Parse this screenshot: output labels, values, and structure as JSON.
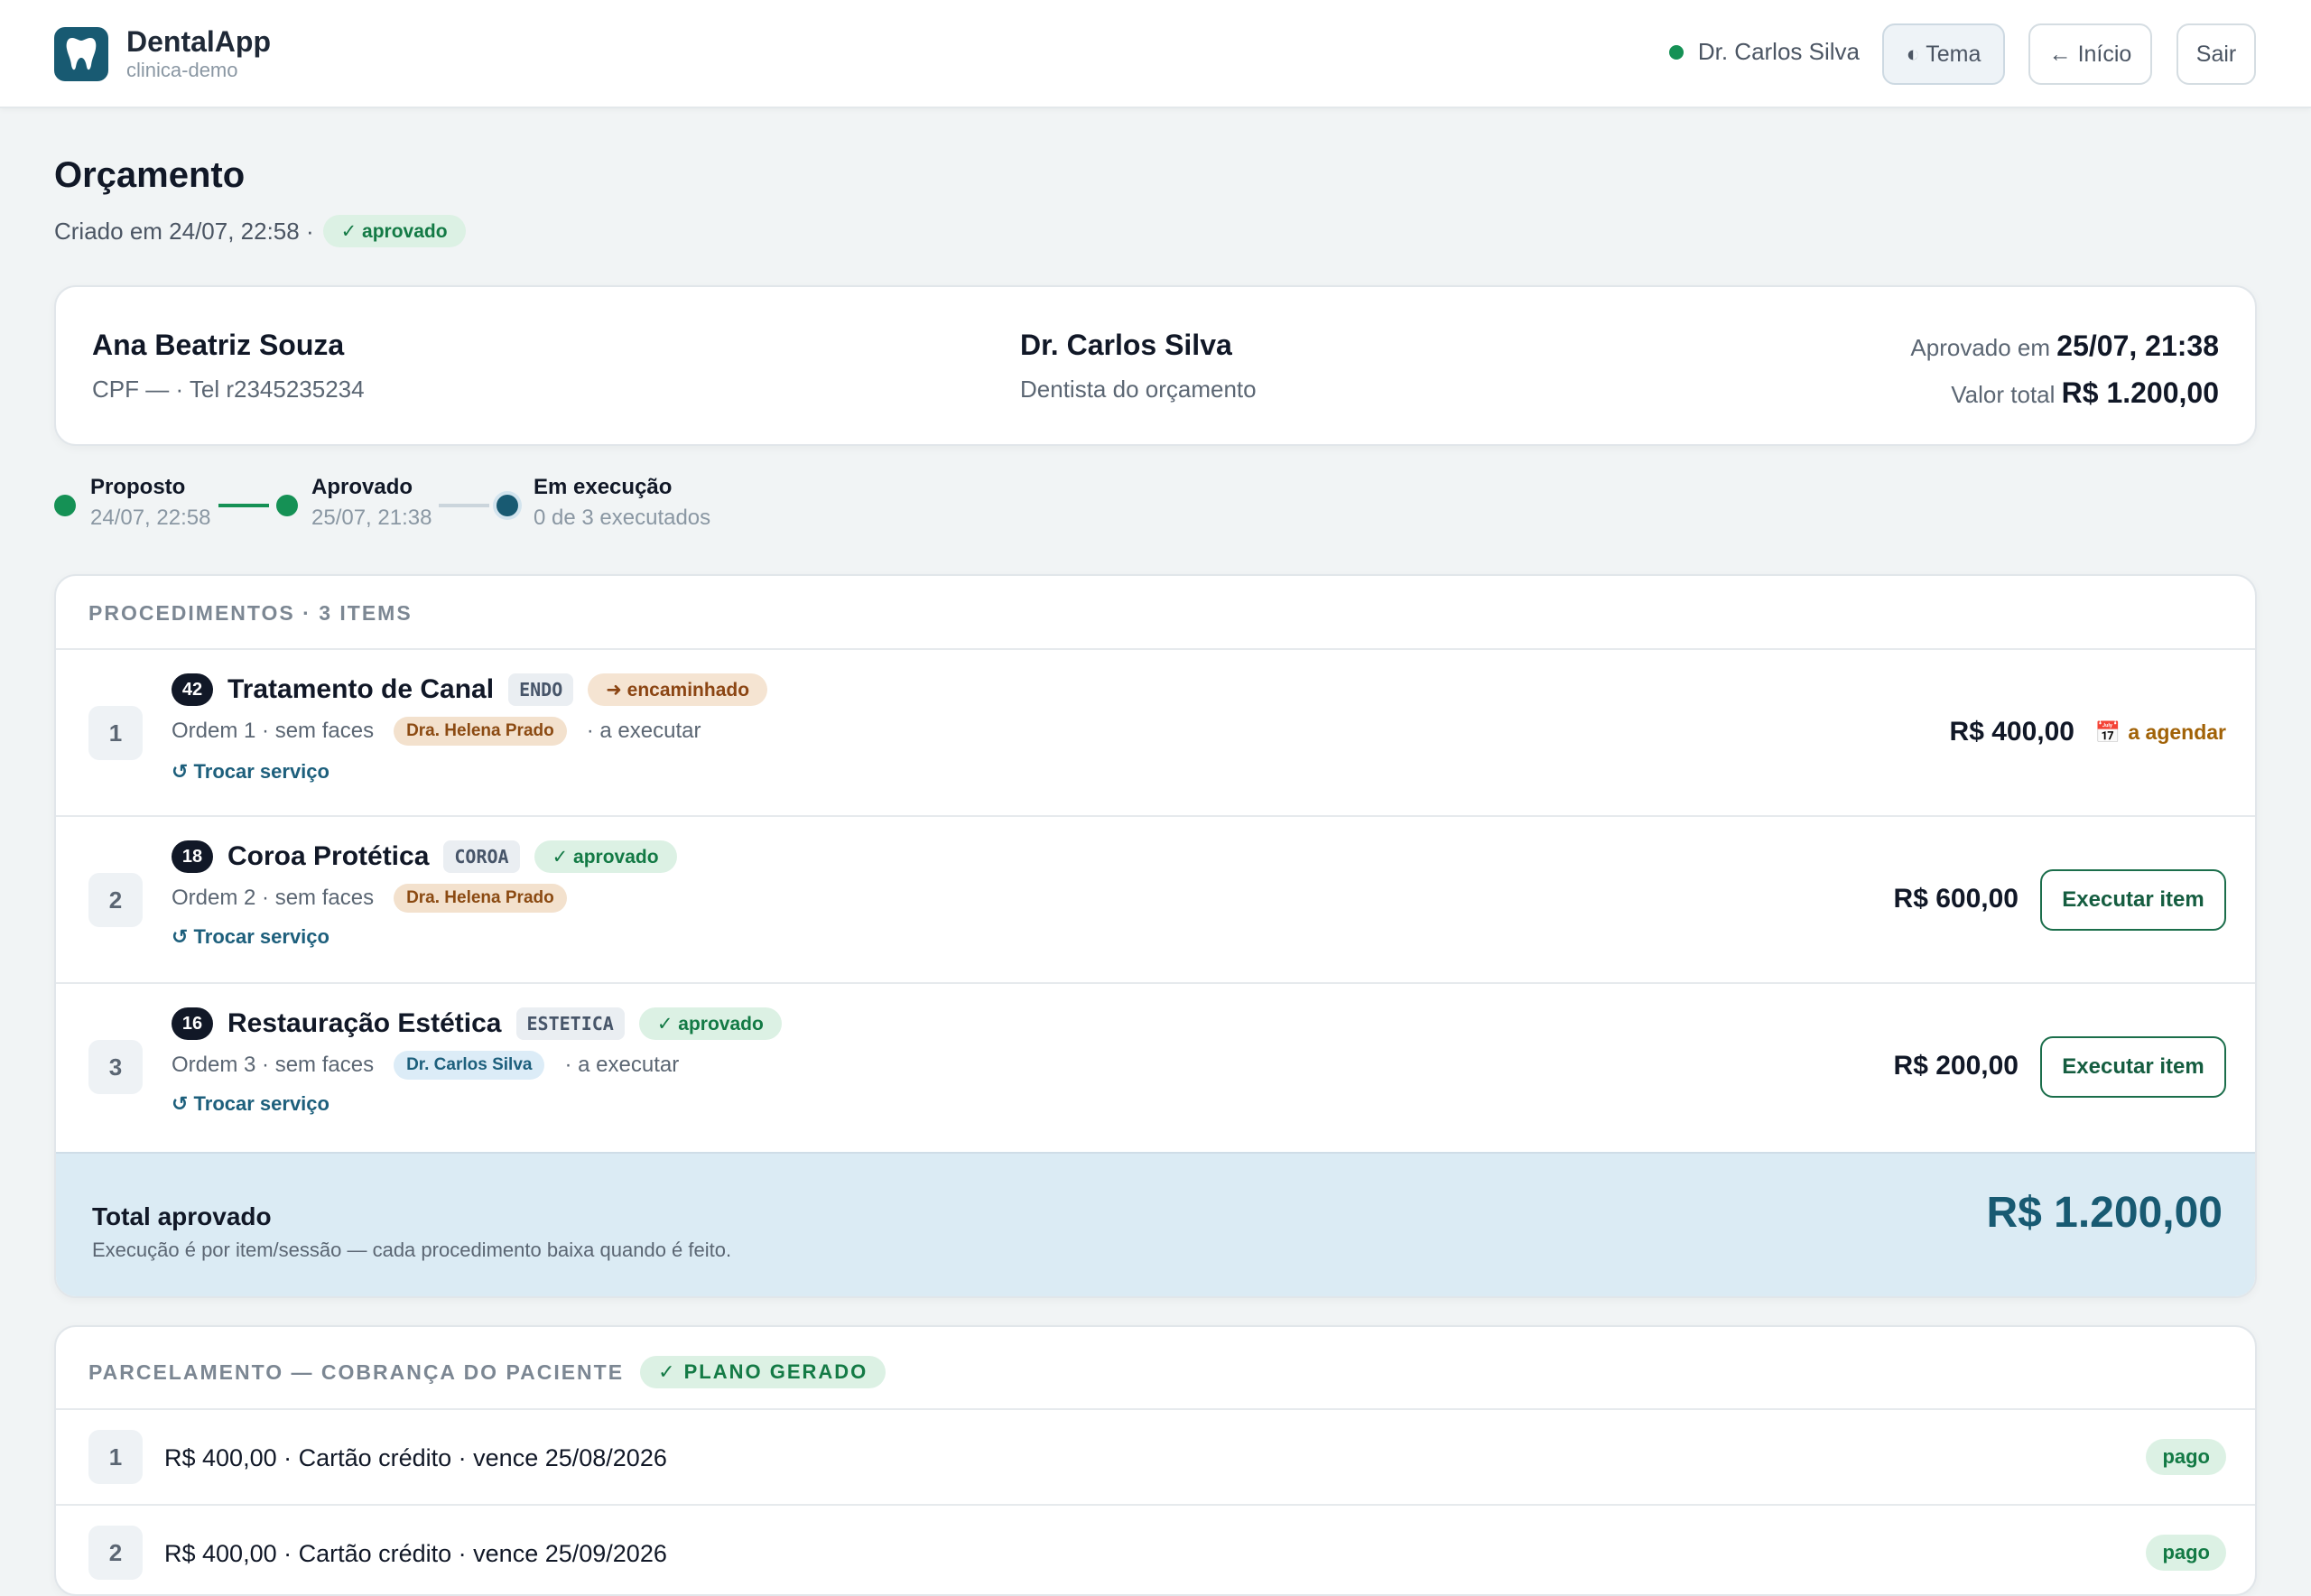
{
  "app": {
    "name": "DentalApp",
    "tenant": "clinica-demo"
  },
  "header": {
    "user": "Dr. Carlos Silva",
    "theme_label": "◐ Tema",
    "home_label": "← Início",
    "logout_label": "Sair"
  },
  "page": {
    "title": "Orçamento",
    "created": "Criado em 24/07, 22:58 ·",
    "status": "✓ aprovado"
  },
  "summary": {
    "patient_name": "Ana Beatriz Souza",
    "patient_meta": "CPF — · Tel r2345235234",
    "dentist_name": "Dr. Carlos Silva",
    "dentist_role": "Dentista do orçamento",
    "approved_label": "Aprovado em",
    "approved_value": "25/07, 21:38",
    "total_label": "Valor total",
    "total_value": "R$ 1.200,00"
  },
  "stepper": [
    {
      "label": "Proposto",
      "sub": "24/07, 22:58",
      "state": "done"
    },
    {
      "label": "Aprovado",
      "sub": "25/07, 21:38",
      "state": "done"
    },
    {
      "label": "Em execução",
      "sub": "0 de 3 executados",
      "state": "current"
    }
  ],
  "procedures": {
    "header": "PROCEDIMENTOS · 3 ITEMS",
    "swap_label": "↺ Trocar serviço",
    "items": [
      {
        "index": "1",
        "tooth": "42",
        "name": "Tratamento de Canal",
        "code": "ENDO",
        "status": "➜ encaminhado",
        "meta": "Ordem 1 · sem faces",
        "professional": "Dra. Helena Prado",
        "exec_status": "· a executar",
        "price": "R$ 400,00",
        "action": "a agendar"
      },
      {
        "index": "2",
        "tooth": "18",
        "name": "Coroa Protética",
        "code": "COROA",
        "status": "✓ aprovado",
        "meta": "Ordem 2 · sem faces",
        "professional": "Dra. Helena Prado",
        "exec_status": "",
        "price": "R$ 600,00",
        "action": "Executar item"
      },
      {
        "index": "3",
        "tooth": "16",
        "name": "Restauração Estética",
        "code": "ESTETICA",
        "status": "✓ aprovado",
        "meta": "Ordem 3 · sem faces",
        "professional": "Dr. Carlos Silva",
        "exec_status": "· a executar",
        "price": "R$ 200,00",
        "action": "Executar item"
      }
    ],
    "total_label": "Total aprovado",
    "total_note": "Execução é por item/sessão — cada procedimento baixa quando é feito.",
    "total_value": "R$ 1.200,00"
  },
  "installments": {
    "header": "PARCELAMENTO — COBRANÇA DO PACIENTE",
    "badge": "✓ PLANO GERADO",
    "items": [
      {
        "index": "1",
        "text": "R$ 400,00 · Cartão crédito · vence 25/08/2026",
        "status": "pago"
      },
      {
        "index": "2",
        "text": "R$ 400,00 · Cartão crédito · vence 25/09/2026",
        "status": "pago"
      }
    ]
  },
  "colors": {
    "brand": "#185a72",
    "success": "#159155",
    "accent_blue": "#1d5f7c"
  }
}
